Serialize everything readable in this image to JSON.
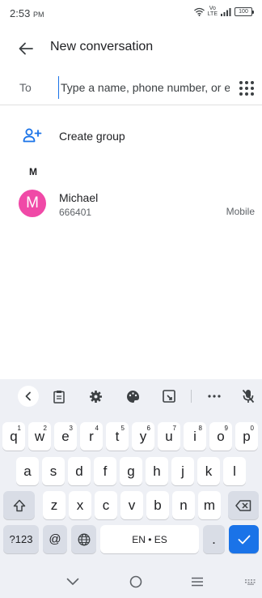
{
  "status_bar": {
    "time": "2:53",
    "ampm": "PM",
    "volte_top": "Vo",
    "volte_bottom": "LTE",
    "battery": "100"
  },
  "app_bar": {
    "title": "New conversation"
  },
  "to_field": {
    "label": "To",
    "placeholder": "Type a name, phone number, or e..."
  },
  "create_group": {
    "label": "Create group"
  },
  "contacts": {
    "section_letter": "M",
    "items": [
      {
        "initial": "M",
        "name": "Michael",
        "number": "666401",
        "type": "Mobile"
      }
    ]
  },
  "keyboard": {
    "row1": [
      {
        "k": "q",
        "h": "1"
      },
      {
        "k": "w",
        "h": "2"
      },
      {
        "k": "e",
        "h": "3"
      },
      {
        "k": "r",
        "h": "4"
      },
      {
        "k": "t",
        "h": "5"
      },
      {
        "k": "y",
        "h": "6"
      },
      {
        "k": "u",
        "h": "7"
      },
      {
        "k": "i",
        "h": "8"
      },
      {
        "k": "o",
        "h": "9"
      },
      {
        "k": "p",
        "h": "0"
      }
    ],
    "row2": [
      "a",
      "s",
      "d",
      "f",
      "g",
      "h",
      "j",
      "k",
      "l"
    ],
    "row3": [
      "z",
      "x",
      "c",
      "v",
      "b",
      "n",
      "m"
    ],
    "symbols_label": "?123",
    "at_label": "@",
    "space_label": "EN • ES",
    "period_label": "."
  },
  "colors": {
    "accent": "#1a73e8",
    "avatar": "#f049a7",
    "keyboard_bg": "#eef0f5"
  },
  "icons": {
    "back": "arrow-left-icon",
    "dialpad": "dialpad-icon",
    "create_group": "group-add-icon",
    "toolbar": [
      "chevron-left-icon",
      "clipboard-icon",
      "gear-icon",
      "palette-icon",
      "resize-icon",
      "more-icon",
      "mic-off-icon"
    ]
  }
}
